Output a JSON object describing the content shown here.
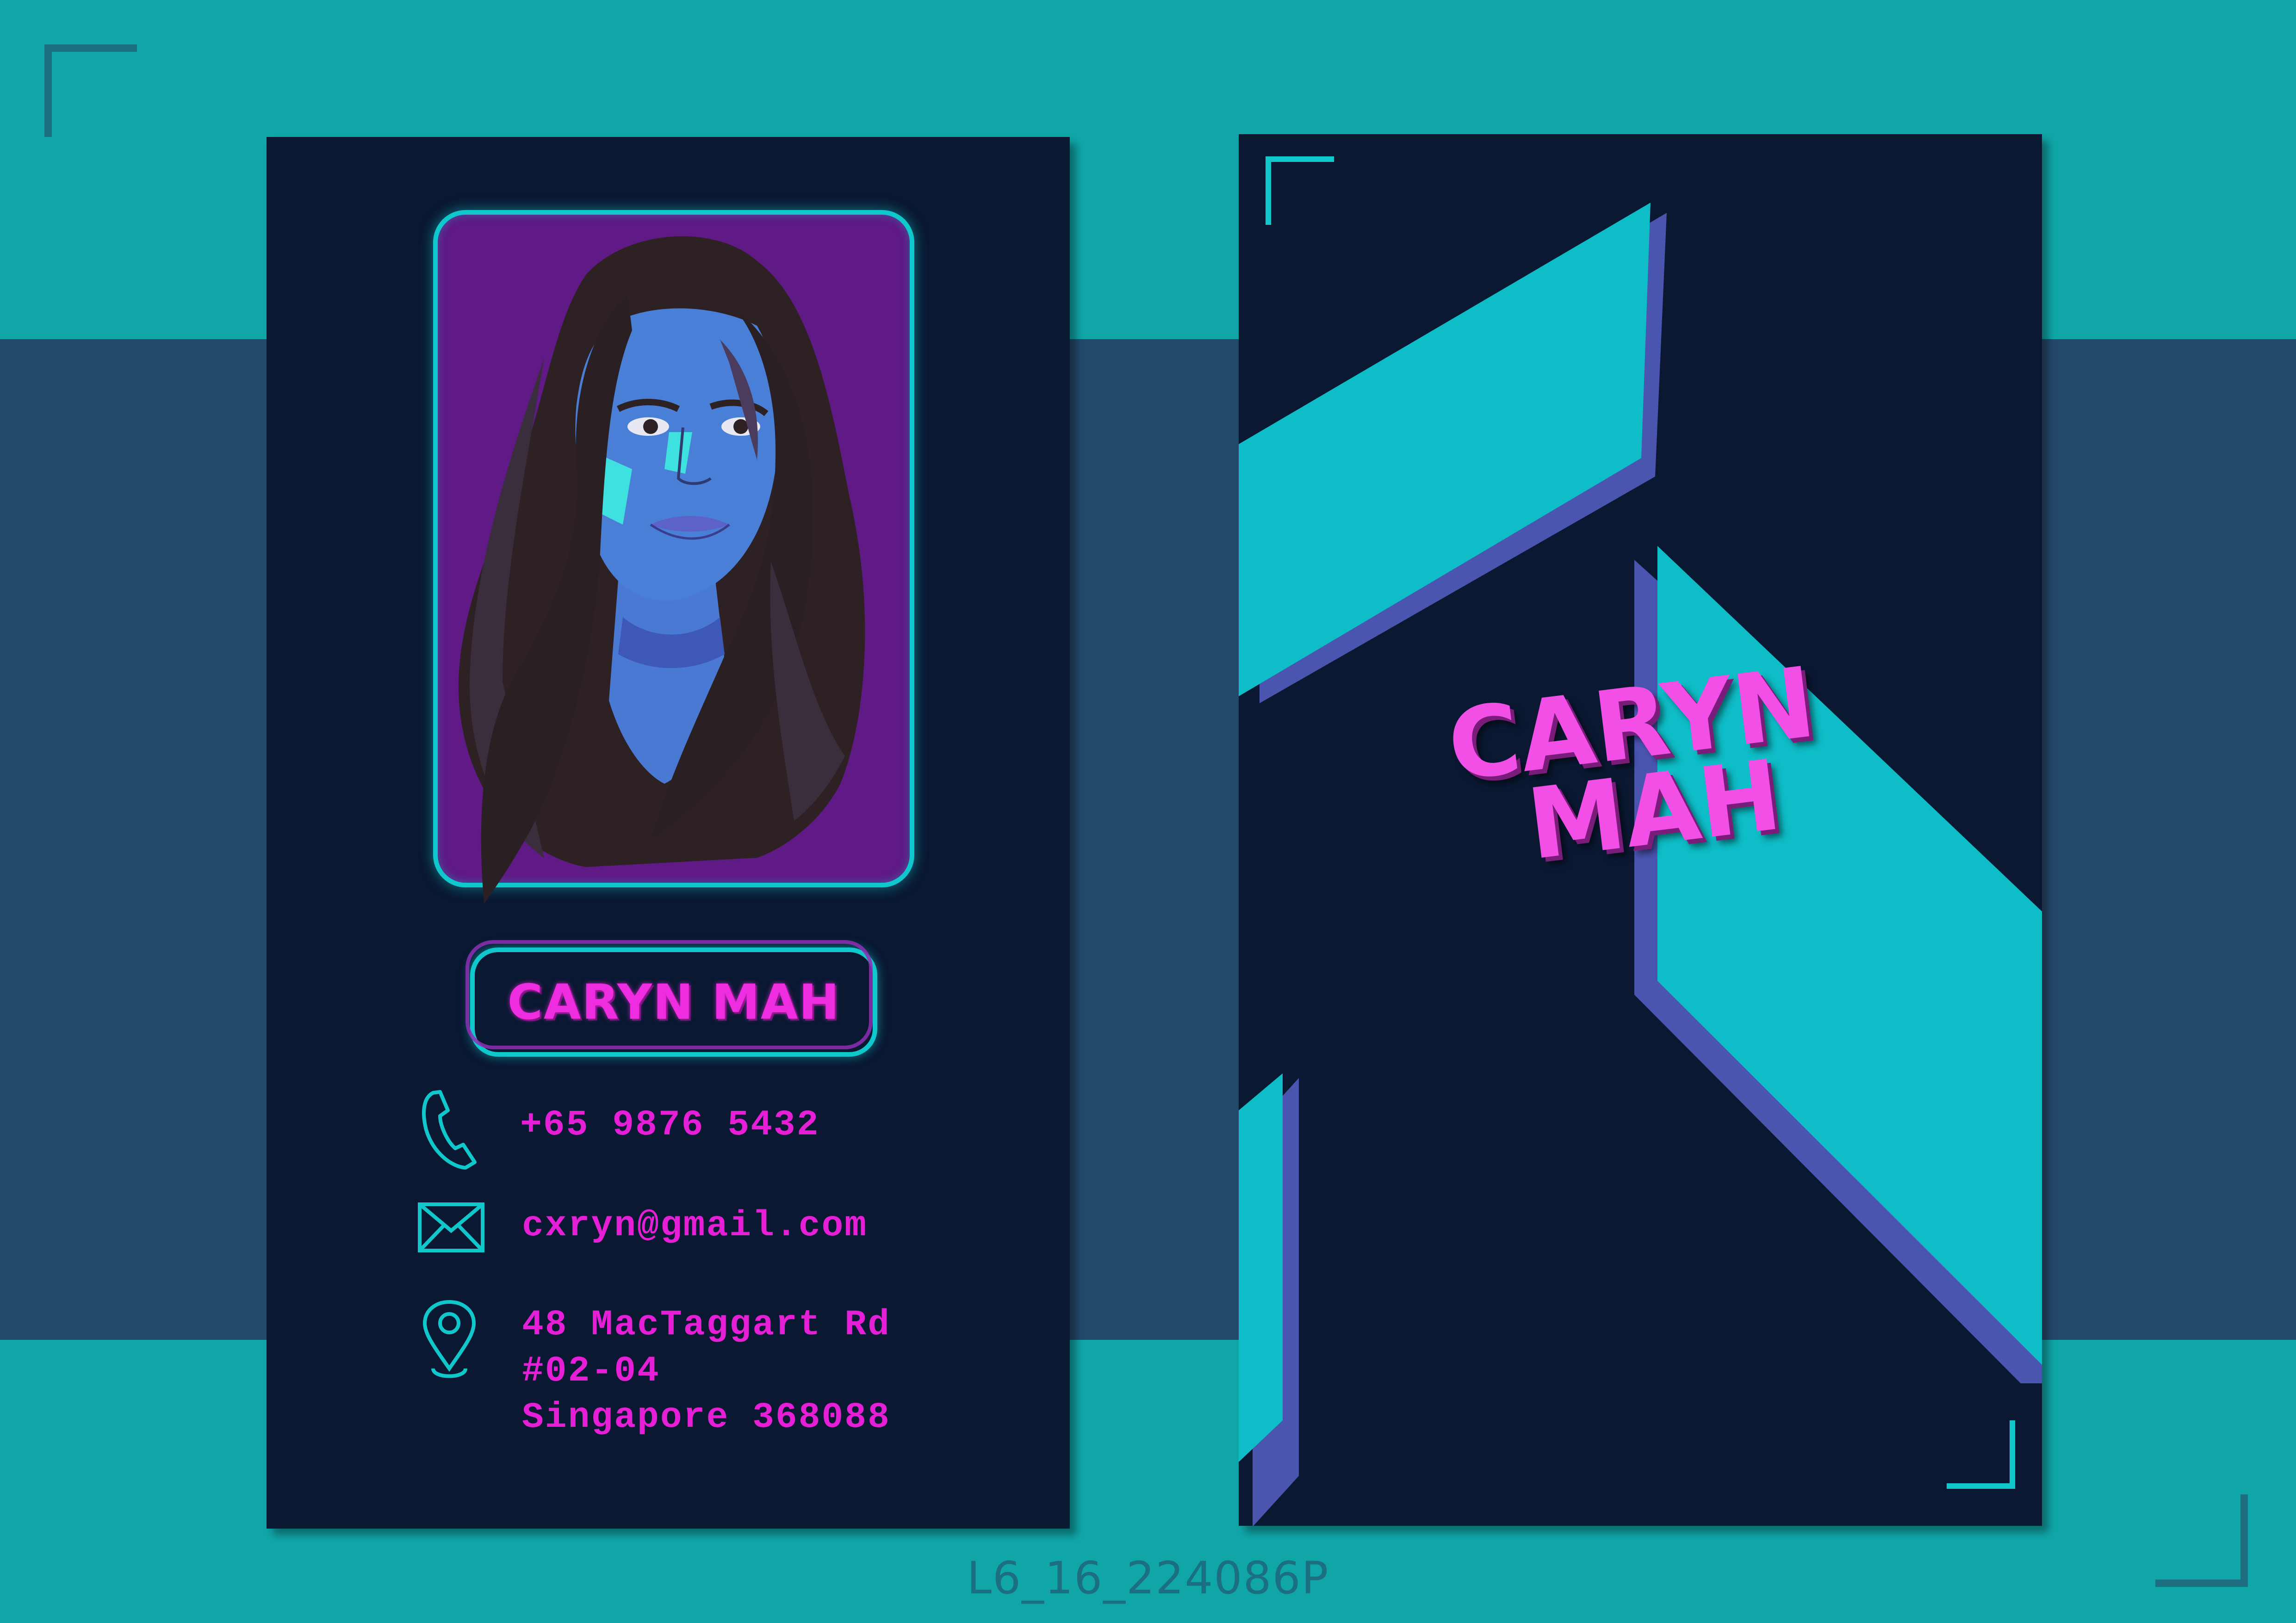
{
  "front": {
    "name": "CARYN MAH",
    "phone": "+65 9876 5432",
    "email": "cxryn@gmail.com",
    "address": [
      "48 MacTaggart Rd",
      "#02-04",
      "Singapore 368088"
    ],
    "icons": [
      "phone-icon",
      "envelope-icon",
      "location-pin-icon"
    ]
  },
  "back": {
    "name_line1": "CARYN",
    "name_line2": "MAH"
  },
  "footer_code": "L6_16_224086P",
  "colors": {
    "background_teal": "#10a6a8",
    "band_blue": "#244a6b",
    "card_navy": "#0a1832",
    "accent_cyan": "#10c8cc",
    "accent_magenta": "#e51fd6",
    "accent_purple": "#5f1a85",
    "shadow_indigo": "#4a55b0"
  }
}
